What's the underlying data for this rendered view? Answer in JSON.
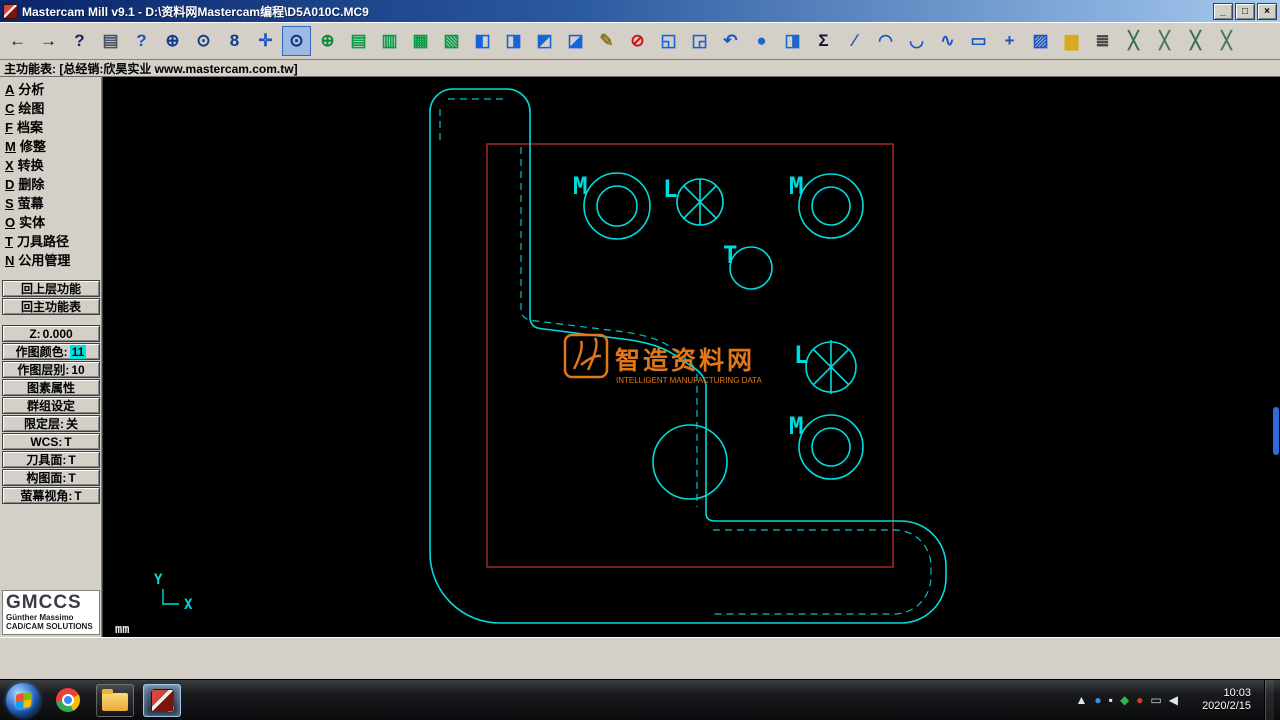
{
  "window": {
    "title": "Mastercam Mill v9.1 - D:\\资料网Mastercam编程\\D5A010C.MC9",
    "controls": [
      {
        "name": "minimize",
        "glyph": "_"
      },
      {
        "name": "maximize",
        "glyph": "□"
      },
      {
        "name": "close",
        "glyph": "×"
      }
    ]
  },
  "toolbar": {
    "icons": [
      {
        "name": "back-arrow",
        "glyph": "←",
        "color": "#111111"
      },
      {
        "name": "forward-arrow",
        "glyph": "→",
        "color": "#111111"
      },
      {
        "name": "help",
        "glyph": "?",
        "color": "#222266"
      },
      {
        "name": "notepad",
        "glyph": "▤",
        "color": "#445566"
      },
      {
        "name": "cursor-help",
        "glyph": "?",
        "color": "#1a56c4"
      },
      {
        "name": "zoom",
        "glyph": "⊕",
        "color": "#123a8f"
      },
      {
        "name": "zoom-window",
        "glyph": "⊙",
        "color": "#123a8f"
      },
      {
        "name": "unzoom-08",
        "glyph": "8",
        "color": "#123a8f"
      },
      {
        "name": "pan",
        "glyph": "✛",
        "color": "#1a56c4"
      },
      {
        "name": "dynamic-zoom",
        "glyph": "⊙",
        "color": "#0b2e74",
        "highlight": true
      },
      {
        "name": "zoom-target",
        "glyph": "⊕",
        "color": "#0a8a3c"
      },
      {
        "name": "gview-top",
        "glyph": "▤",
        "color": "#0a9a4a"
      },
      {
        "name": "gview-front",
        "glyph": "▥",
        "color": "#0a9a4a"
      },
      {
        "name": "gview-side",
        "glyph": "▦",
        "color": "#0a9a4a"
      },
      {
        "name": "gview-isometric",
        "glyph": "▧",
        "color": "#0a9a4a"
      },
      {
        "name": "cplane-top",
        "glyph": "◧",
        "color": "#1565d8"
      },
      {
        "name": "cplane-front",
        "glyph": "◨",
        "color": "#1565d8"
      },
      {
        "name": "cplane-side",
        "glyph": "◩",
        "color": "#1565d8"
      },
      {
        "name": "cplane-3d",
        "glyph": "◪",
        "color": "#1565d8"
      },
      {
        "name": "attributes-pencil",
        "glyph": "✎",
        "color": "#8a7420"
      },
      {
        "name": "delete",
        "glyph": "⊘",
        "color": "#cc1111"
      },
      {
        "name": "screen-copy",
        "glyph": "◱",
        "color": "#1565d8"
      },
      {
        "name": "screen-paste",
        "glyph": "◲",
        "color": "#1565d8"
      },
      {
        "name": "undo",
        "glyph": "↶",
        "color": "#1a56c4"
      },
      {
        "name": "shading-sphere",
        "glyph": "●",
        "color": "#1e66cc"
      },
      {
        "name": "viewport",
        "glyph": "◨",
        "color": "#1e66cc"
      },
      {
        "name": "analyze-sigma",
        "glyph": "Σ",
        "color": "#111133"
      },
      {
        "name": "create-line",
        "glyph": "∕",
        "color": "#1a56c4"
      },
      {
        "name": "create-arc",
        "glyph": "◠",
        "color": "#1a56c4"
      },
      {
        "name": "create-fillet",
        "glyph": "◡",
        "color": "#1a56c4"
      },
      {
        "name": "create-spline",
        "glyph": "∿",
        "color": "#1a56c4"
      },
      {
        "name": "create-rectangle",
        "glyph": "▭",
        "color": "#1a56c4"
      },
      {
        "name": "create-point",
        "glyph": "+",
        "color": "#1a56c4"
      },
      {
        "name": "xform-hatch",
        "glyph": "▨",
        "color": "#1a56c4"
      },
      {
        "name": "file-folder",
        "glyph": "▆",
        "color": "#d8a820"
      },
      {
        "name": "layers",
        "glyph": "≣",
        "color": "#444444"
      },
      {
        "name": "trim-one-entity",
        "glyph": "╳",
        "color": "#3c6e5a"
      },
      {
        "name": "trim-two-entity",
        "glyph": "╳",
        "color": "#4a7a66"
      },
      {
        "name": "trim-three-entity",
        "glyph": "╳",
        "color": "#3c6e5a"
      },
      {
        "name": "trim-divide",
        "glyph": "╳",
        "color": "#4a7a66"
      }
    ]
  },
  "prompt": "主功能表: [总经销:欣昊实业 www.mastercam.com.tw]",
  "sidebar": {
    "menu": [
      {
        "key": "A",
        "label": "分析"
      },
      {
        "key": "C",
        "label": "绘图"
      },
      {
        "key": "F",
        "label": "档案"
      },
      {
        "key": "M",
        "label": "修整"
      },
      {
        "key": "X",
        "label": "转换"
      },
      {
        "key": "D",
        "label": "删除"
      },
      {
        "key": "S",
        "label": "萤幕"
      },
      {
        "key": "O",
        "label": "实体"
      },
      {
        "key": "T",
        "label": "刀具路径"
      },
      {
        "key": "N",
        "label": "公用管理"
      }
    ],
    "nav": [
      {
        "label": "回上层功能"
      },
      {
        "label": "回主功能表"
      }
    ],
    "status": [
      {
        "label": "Z:",
        "value": "0.000"
      },
      {
        "label": "作图颜色:",
        "value": "11"
      },
      {
        "label": "作图层别:",
        "value": "10"
      },
      {
        "label": "图素属性",
        "value": ""
      },
      {
        "label": "群组设定",
        "value": ""
      },
      {
        "label": "限定层:",
        "value": "关"
      },
      {
        "label": "WCS:",
        "value": "T"
      },
      {
        "label": "刀具面:",
        "value": "T"
      },
      {
        "label": "构图面:",
        "value": "T"
      },
      {
        "label": "萤幕视角:",
        "value": "T"
      }
    ],
    "logo": {
      "name": "GMCCS",
      "line1": "Günther Massimo",
      "line2": "CAD/CAM SOLUTIONS"
    }
  },
  "canvas": {
    "unit": "mm",
    "axis": {
      "x": "X",
      "y": "Y"
    },
    "holes": [
      {
        "label": "M"
      },
      {
        "label": "L"
      },
      {
        "label": "M"
      },
      {
        "label": "T"
      },
      {
        "label": "L"
      },
      {
        "label": "M"
      }
    ],
    "watermark": {
      "text": "智造资料网",
      "subtext": "INTELLIGENT MANUFACTURING DATA"
    },
    "colors": {
      "geometry": "#00dcdc",
      "stock": "#cc3333",
      "watermark": "#e07818"
    }
  },
  "taskbar": {
    "tray": [
      {
        "name": "hidden-icons",
        "glyph": "▲",
        "color": "#dfe6ec"
      },
      {
        "name": "app-blue",
        "glyph": "●",
        "color": "#3f8fdf"
      },
      {
        "name": "input-indicator",
        "glyph": "▪",
        "color": "#e8e8e8"
      },
      {
        "name": "security-shield",
        "glyph": "◆",
        "color": "#35b24a"
      },
      {
        "name": "alert",
        "glyph": "●",
        "color": "#d23c2a"
      },
      {
        "name": "display",
        "glyph": "▭",
        "color": "#cfd6dd"
      },
      {
        "name": "volume",
        "glyph": "◀",
        "color": "#dfe6ec"
      }
    ],
    "clock": {
      "time": "10:03",
      "date": "2020/2/15"
    }
  }
}
